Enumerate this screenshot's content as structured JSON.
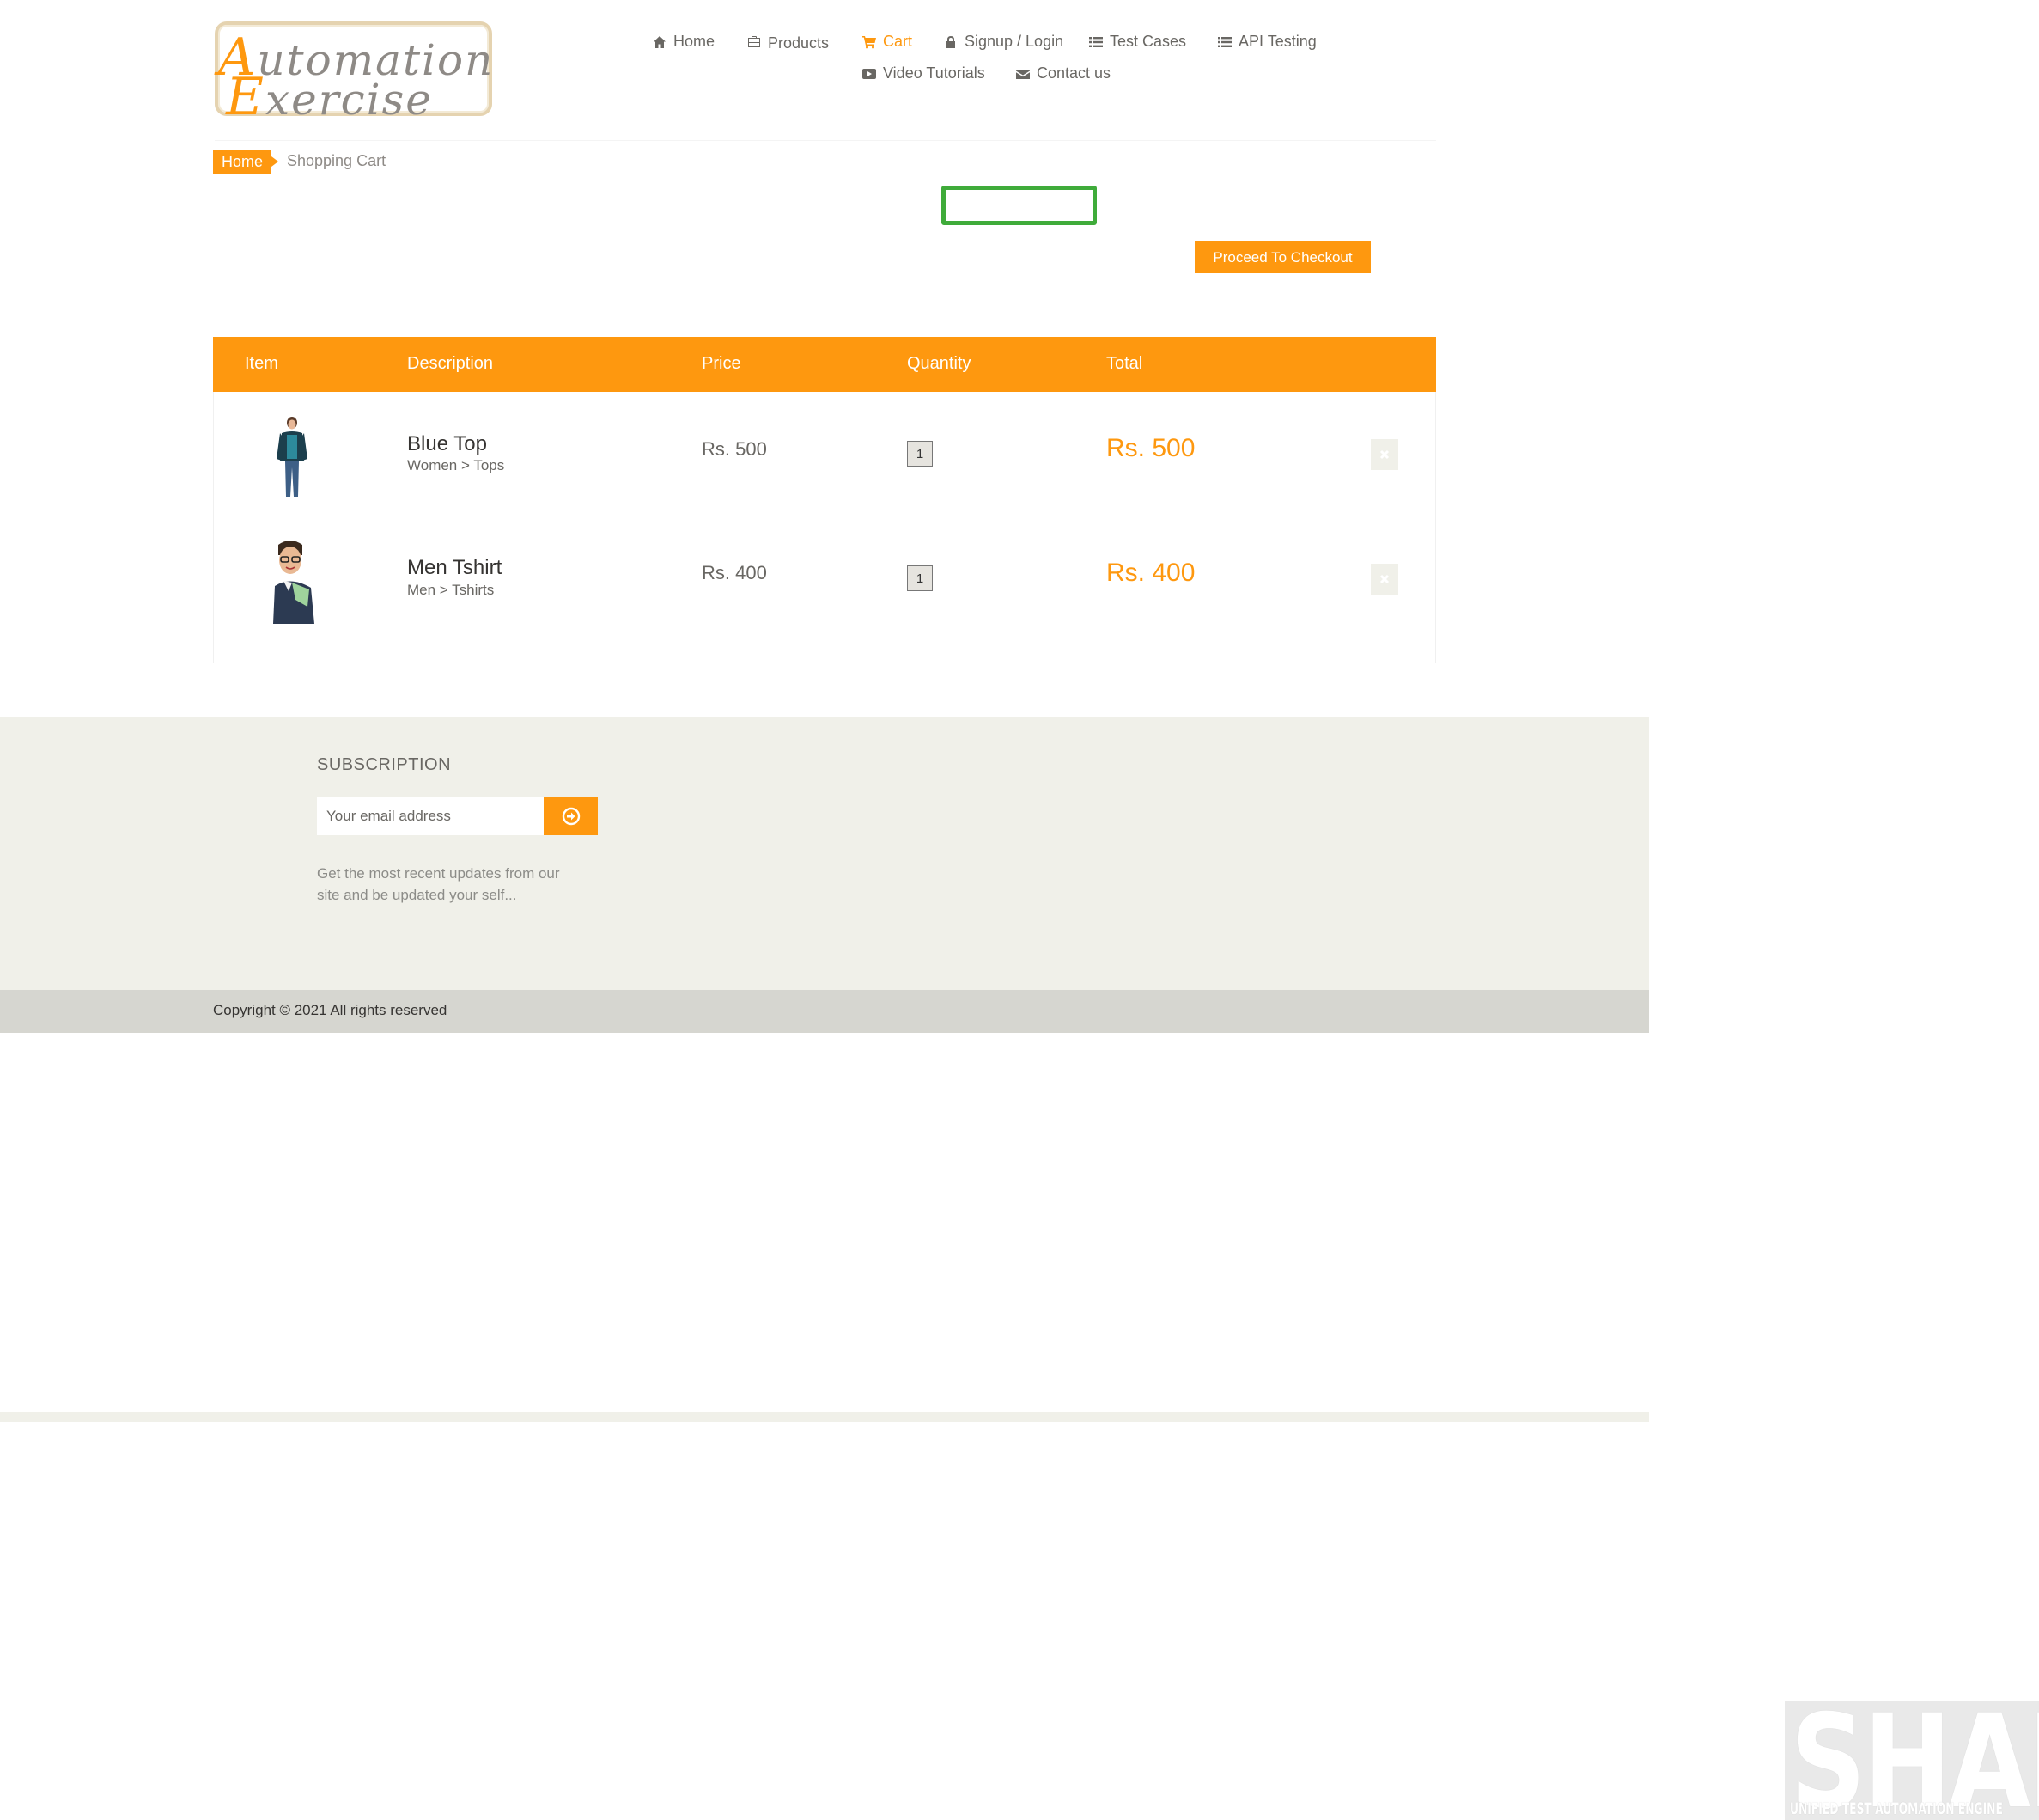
{
  "logo": {
    "line1_cap": "A",
    "line1_rest": "utomation",
    "line2_cap": "E",
    "line2_rest": "xercise"
  },
  "nav": {
    "home": {
      "label": "Home",
      "icon": "home-icon"
    },
    "products": {
      "label": "Products",
      "icon": "briefcase-icon"
    },
    "cart": {
      "label": "Cart",
      "icon": "shopping-cart-icon"
    },
    "signup": {
      "label": "Signup / Login",
      "icon": "lock-icon"
    },
    "test_cases": {
      "label": "Test Cases",
      "icon": "list-icon"
    },
    "api_testing": {
      "label": "API Testing",
      "icon": "list-icon"
    },
    "video_tutorials": {
      "label": "Video Tutorials",
      "icon": "youtube-play-icon"
    },
    "contact": {
      "label": "Contact us",
      "icon": "envelope-icon"
    }
  },
  "breadcrumb": {
    "home": "Home",
    "current": "Shopping Cart"
  },
  "checkout_button": "Proceed To Checkout",
  "table": {
    "headers": {
      "item": "Item",
      "description": "Description",
      "price": "Price",
      "quantity": "Quantity",
      "total": "Total"
    },
    "rows": [
      {
        "name": "Blue Top",
        "category": "Women > Tops",
        "price": "Rs. 500",
        "quantity": "1",
        "total": "Rs. 500"
      },
      {
        "name": "Men Tshirt",
        "category": "Men > Tshirts",
        "price": "Rs. 400",
        "quantity": "1",
        "total": "Rs. 400"
      }
    ]
  },
  "footer": {
    "subscription_title": "SUBSCRIPTION",
    "email_placeholder": "Your email address",
    "note": "Get the most recent updates from our site and be updated your self...",
    "copyright": "Copyright © 2021 All rights reserved"
  },
  "watermark": {
    "title": "SHAFT",
    "subtitle": "UNIFIED TEST AUTOMATION ENGINE"
  },
  "colors": {
    "accent": "#fe980f",
    "highlight": "#3fab3a",
    "footer_bg": "#f0f0e9"
  }
}
